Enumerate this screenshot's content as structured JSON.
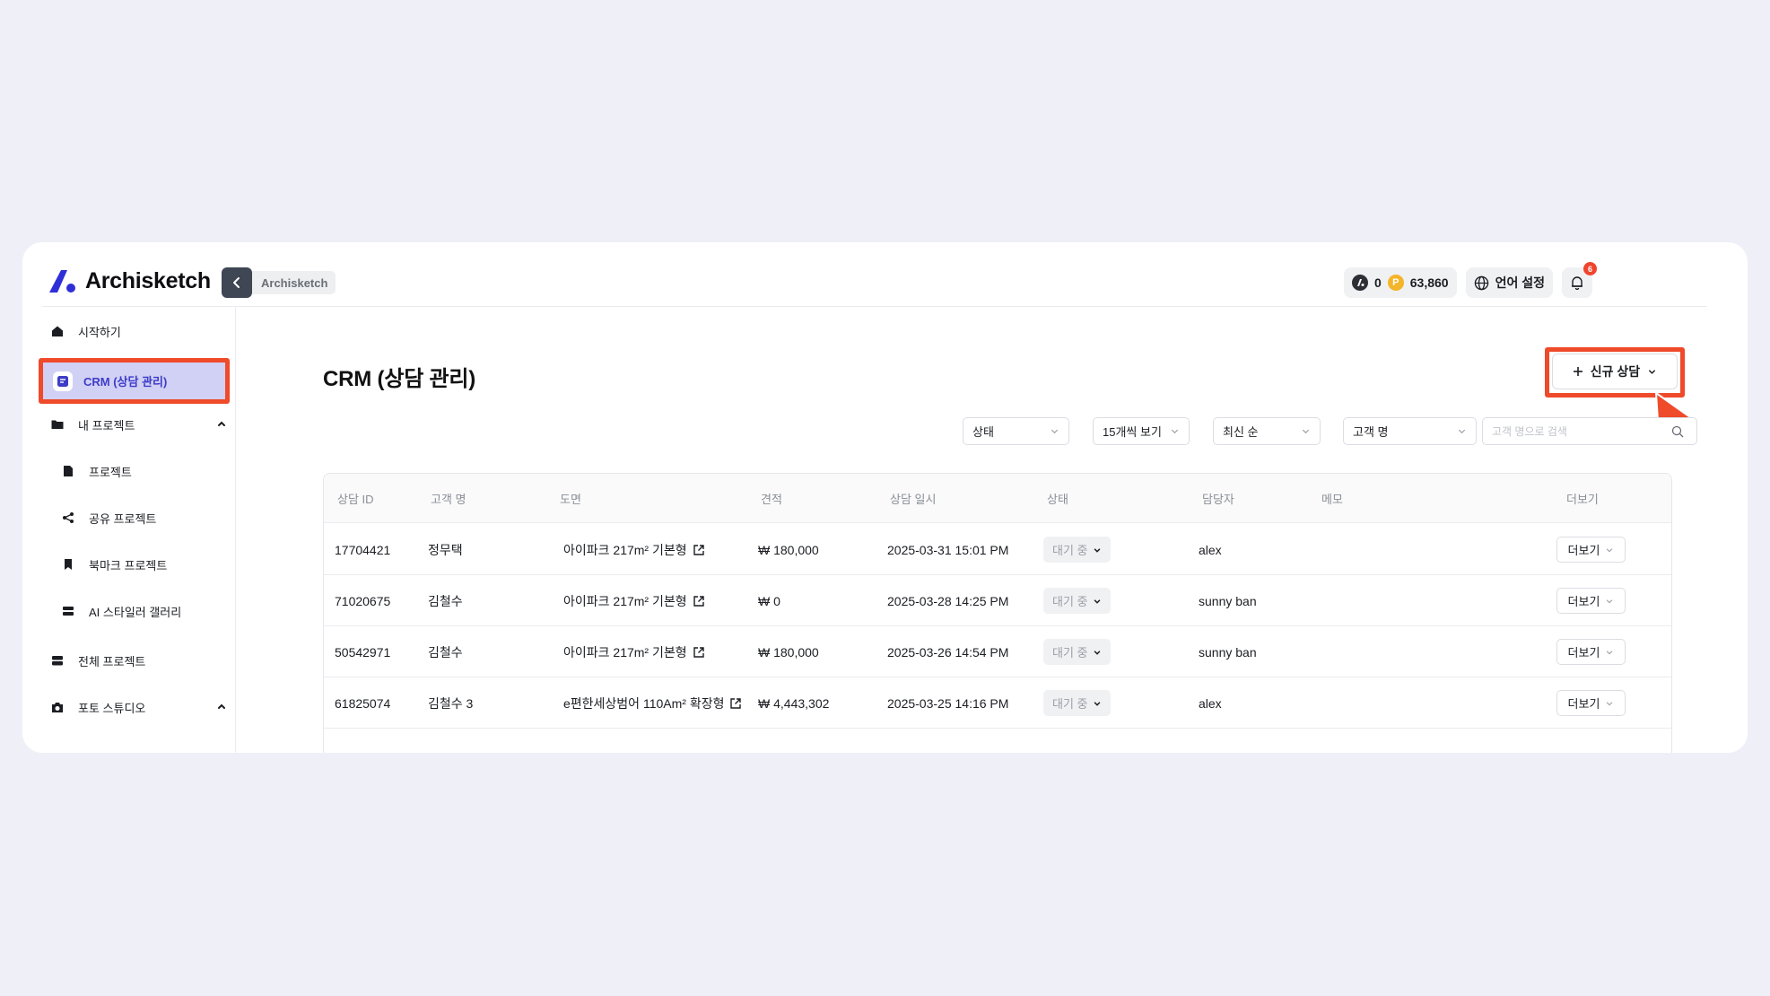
{
  "app": {
    "name": "Archisketch",
    "breadcrumb": "Archisketch"
  },
  "header": {
    "credit_value": "0",
    "points_value": "63,860",
    "points_coin_letter": "P",
    "language_label": "언어 설정",
    "notification_count": "6"
  },
  "sidebar": {
    "items": [
      {
        "label": "시작하기",
        "icon": "home-icon"
      },
      {
        "label": "CRM (상담 관리)",
        "icon": "crm-icon",
        "active": true
      },
      {
        "label": "내 프로젝트",
        "icon": "folder-icon",
        "expanded": true
      },
      {
        "label": "프로젝트",
        "icon": "file-icon"
      },
      {
        "label": "공유 프로젝트",
        "icon": "share-icon"
      },
      {
        "label": "북마크 프로젝트",
        "icon": "bookmark-icon"
      },
      {
        "label": "AI 스타일러 갤러리",
        "icon": "gallery-icon"
      },
      {
        "label": "전체 프로젝트",
        "icon": "stack-icon"
      },
      {
        "label": "포토 스튜디오",
        "icon": "camera-icon",
        "expanded": true
      }
    ]
  },
  "main": {
    "title": "CRM (상담 관리)",
    "new_button_label": "신규 상담",
    "filters": {
      "status": "상태",
      "page_size": "15개씩 보기",
      "sort": "최신 순",
      "search_field": "고객 명",
      "search_placeholder": "고객 명으로 검색"
    },
    "table": {
      "columns": [
        "상담 ID",
        "고객 명",
        "도면",
        "견적",
        "상담 일시",
        "상태",
        "담당자",
        "메모",
        "더보기"
      ],
      "rows": [
        {
          "id": "17704421",
          "customer": "정무택",
          "plan": "아이파크 217m² 기본형",
          "estimate": "₩ 180,000",
          "datetime": "2025-03-31 15:01 PM",
          "status": "대기 중",
          "manager": "alex",
          "memo": "",
          "more": "더보기"
        },
        {
          "id": "71020675",
          "customer": "김철수",
          "plan": "아이파크 217m² 기본형",
          "estimate": "₩ 0",
          "datetime": "2025-03-28 14:25 PM",
          "status": "대기 중",
          "manager": "sunny ban",
          "memo": "",
          "more": "더보기"
        },
        {
          "id": "50542971",
          "customer": "김철수",
          "plan": "아이파크 217m² 기본형",
          "estimate": "₩ 180,000",
          "datetime": "2025-03-26 14:54 PM",
          "status": "대기 중",
          "manager": "sunny ban",
          "memo": "",
          "more": "더보기"
        },
        {
          "id": "61825074",
          "customer": "김철수 3",
          "plan": "e편한세상범어 110Am² 확장형",
          "estimate": "₩ 4,443,302",
          "datetime": "2025-03-25 14:16 PM",
          "status": "대기 중",
          "manager": "alex",
          "memo": "",
          "more": "더보기"
        }
      ]
    }
  },
  "colors": {
    "accent": "#3c3cc8",
    "highlight": "#ef4a2a",
    "active_bg": "#d1d0f5",
    "background": "#efeff7"
  }
}
